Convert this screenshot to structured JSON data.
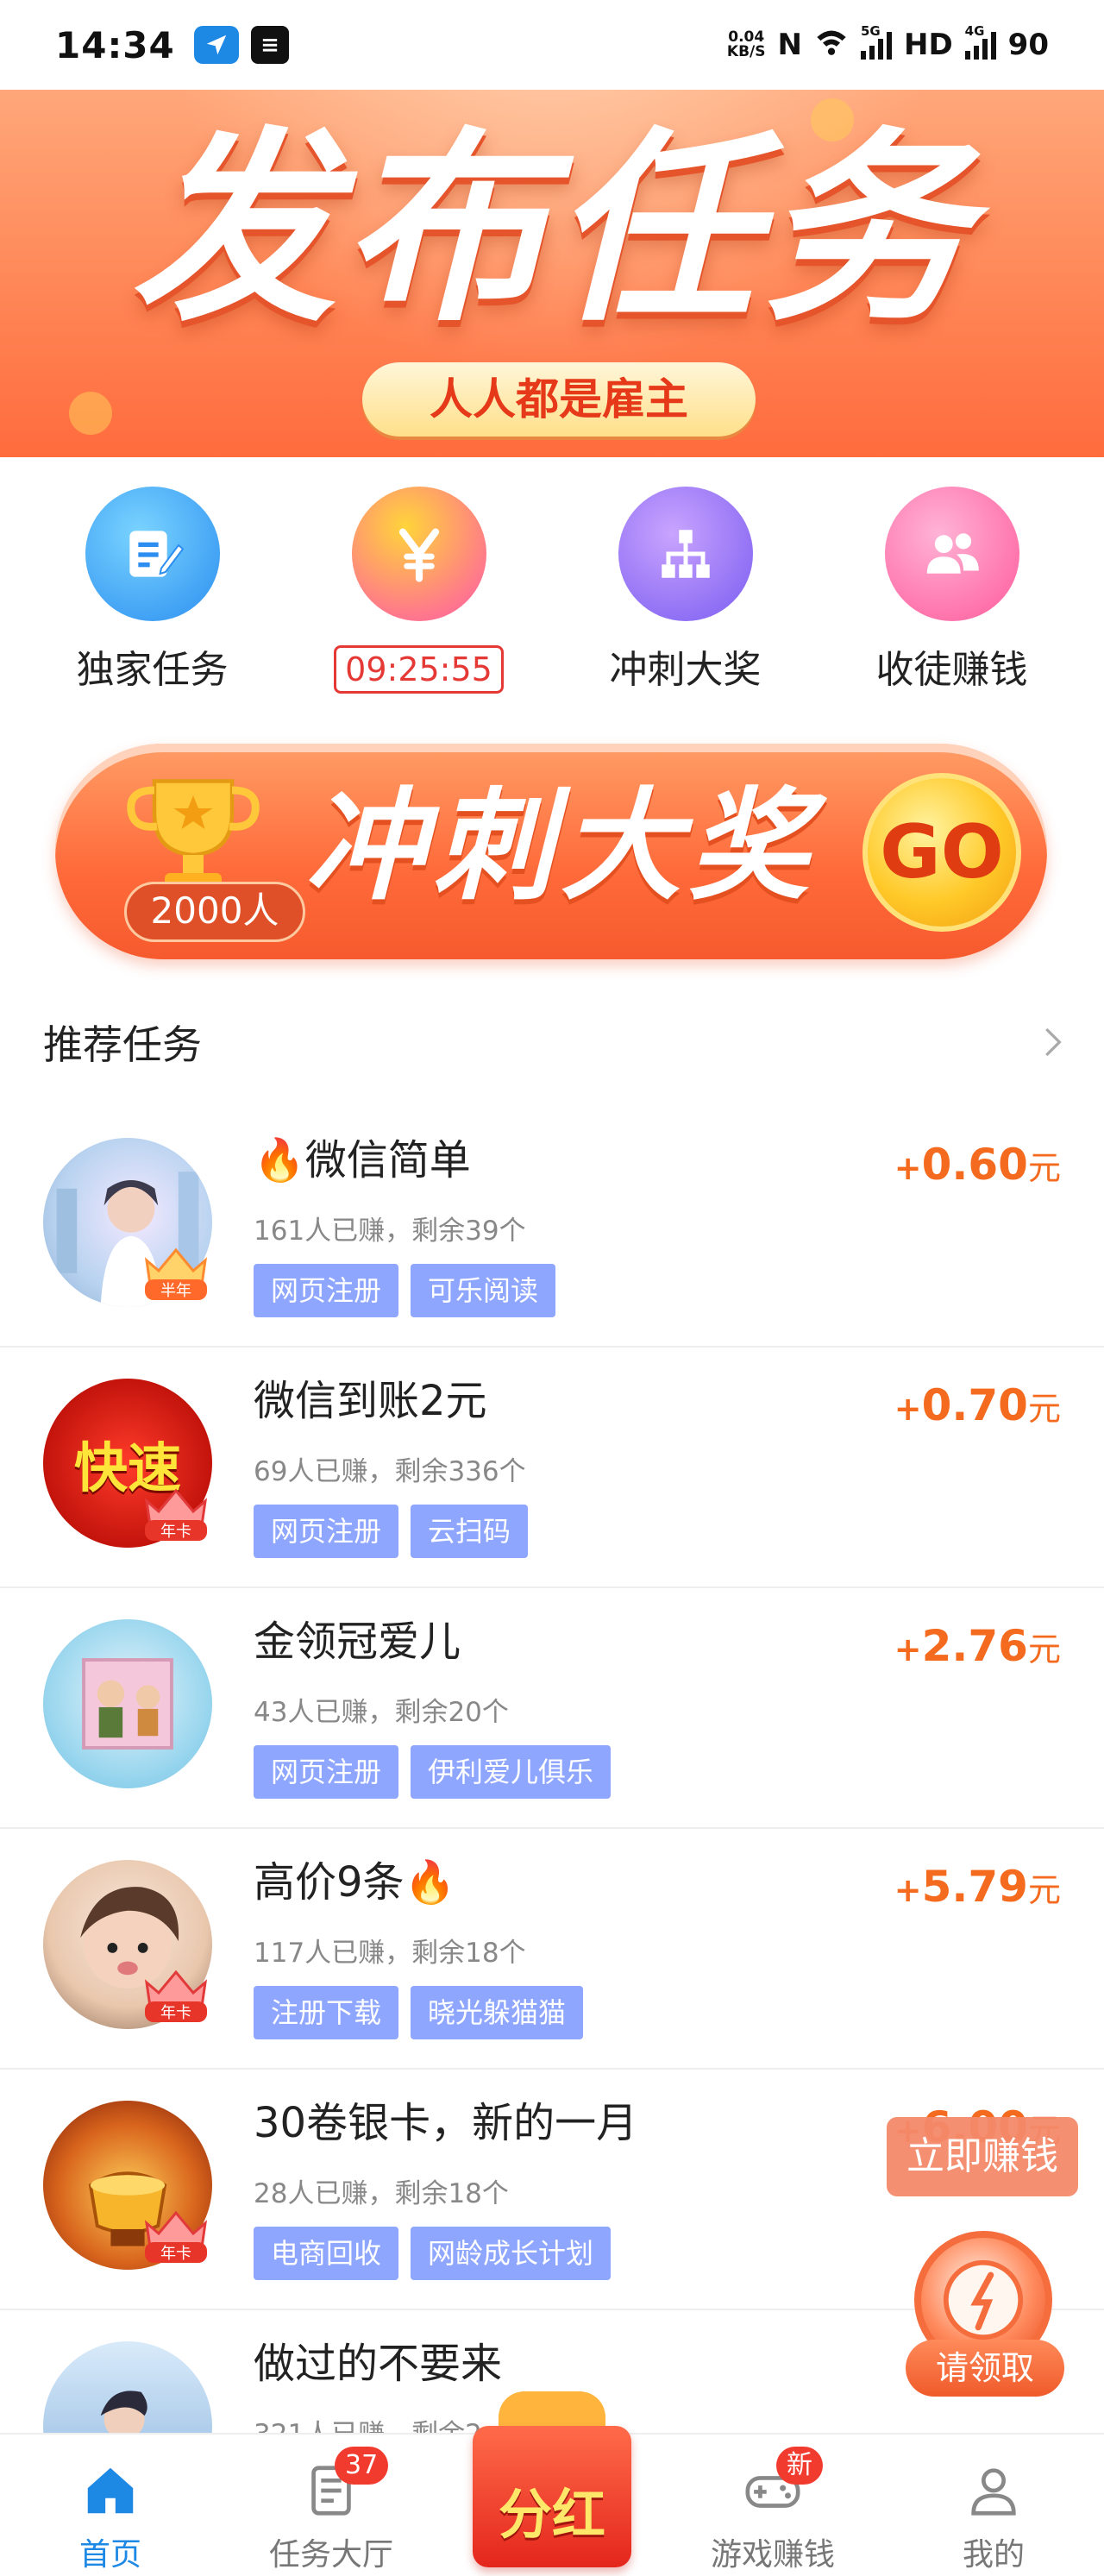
{
  "status_bar": {
    "time": "14:34",
    "speed_value": "0.04",
    "speed_unit": "KB/S",
    "signal1_tag": "5G",
    "hd_label": "HD",
    "signal2_tag": "4G",
    "battery": "90"
  },
  "banner": {
    "title": "发布任务",
    "subtitle": "人人都是雇主"
  },
  "quick_menu": [
    {
      "label": "独家任务",
      "icon": "edit-icon",
      "color_from": "#58c3ff",
      "color_to": "#2b8ef0"
    },
    {
      "timer": "09:25:55",
      "icon": "yen-icon",
      "color_from": "#ffcf3a",
      "color_to": "#ff6aa0"
    },
    {
      "label": "冲刺大奖",
      "icon": "org-chart-icon",
      "color_from": "#b98bff",
      "color_to": "#7a5cf0"
    },
    {
      "label": "收徒赚钱",
      "icon": "users-icon",
      "color_from": "#ff9ac9",
      "color_to": "#ff5a9a"
    }
  ],
  "sprint_banner": {
    "title": "冲刺大奖",
    "go_label": "GO",
    "count_label": "2000人"
  },
  "section": {
    "title": "推荐任务"
  },
  "tasks": [
    {
      "title": "🔥微信简单",
      "meta": "161人已赚，剩余39个",
      "tags": [
        "网页注册",
        "可乐阅读"
      ],
      "plus": "+",
      "amount": "0.60",
      "unit": "元",
      "badge": "半年",
      "avatar_color": "#b9d3f0"
    },
    {
      "title": "微信到账2元",
      "meta": "69人已赚，剩余336个",
      "tags": [
        "网页注册",
        "云扫码"
      ],
      "plus": "+",
      "amount": "0.70",
      "unit": "元",
      "badge": "年卡",
      "avatar_color": "#e02a1c",
      "avatar_text": "快速"
    },
    {
      "title": "金领冠爱儿",
      "meta": "43人已赚，剩余20个",
      "tags": [
        "网页注册",
        "伊利爱儿俱乐"
      ],
      "plus": "+",
      "amount": "2.76",
      "unit": "元",
      "badge": "",
      "avatar_color": "#9ed8ef"
    },
    {
      "title": "高价9条🔥",
      "meta": "117人已赚，剩余18个",
      "tags": [
        "注册下载",
        "晓光躲猫猫"
      ],
      "plus": "+",
      "amount": "5.79",
      "unit": "元",
      "badge": "年卡",
      "avatar_color": "#e9c7ad"
    },
    {
      "title": "30卷银卡，新的一月",
      "meta": "28人已赚，剩余18个",
      "tags": [
        "电商回收",
        "网龄成长计划"
      ],
      "plus": "+",
      "amount": "6.00",
      "unit": "元",
      "badge": "年卡",
      "avatar_color": "#c4471c"
    },
    {
      "title": "做过的不要来",
      "meta": "321人已赚，剩余2",
      "tags": [],
      "plus": "",
      "amount": "",
      "unit": "",
      "badge": "",
      "avatar_color": "#a9c9e9"
    }
  ],
  "floating": {
    "earn_now": "立即赚钱",
    "claim": "请领取"
  },
  "tabbar": {
    "home": "首页",
    "task_hall": "任务大厅",
    "task_hall_badge": "37",
    "dividend": "分红",
    "game": "游戏赚钱",
    "game_badge": "新",
    "mine": "我的"
  },
  "colors": {
    "accent_blue": "#1e88e5",
    "reward_orange": "#f46a1e",
    "tag_blue": "#8fa6ff",
    "badge_red": "#f23b2f"
  }
}
